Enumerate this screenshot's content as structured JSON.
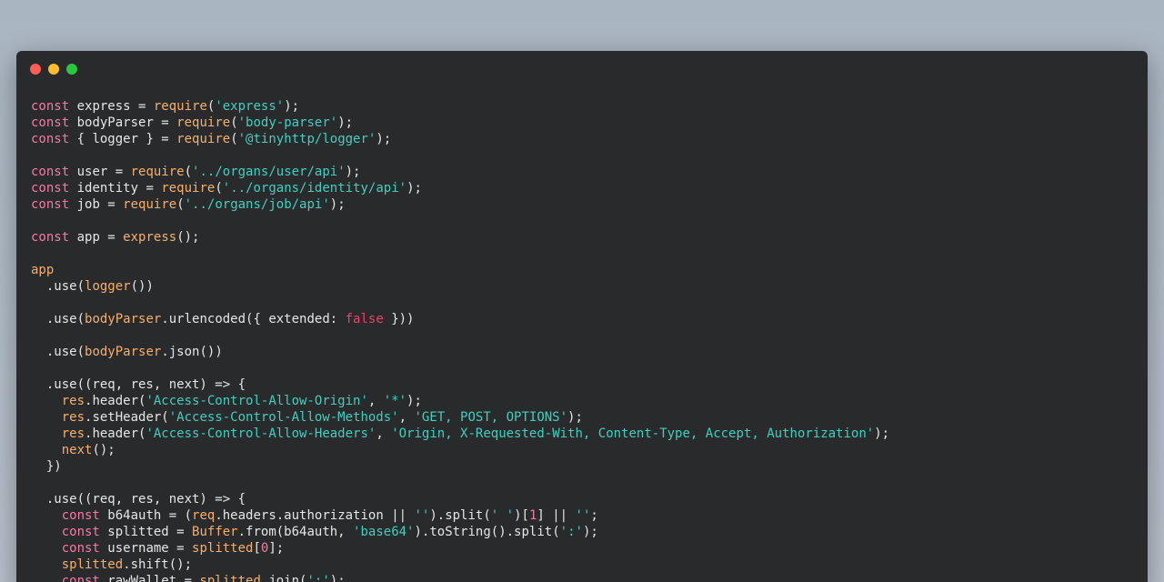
{
  "theme": {
    "background_top": "#a9b5c1",
    "window_bg": "#282a2c",
    "traffic_lights": {
      "close": "#ff5f56",
      "minimize": "#ffbd2e",
      "zoom": "#27c93f"
    },
    "token_colors": {
      "keyword": "#f47ba0",
      "function": "#f5b06a",
      "string": "#3fd0c0",
      "plain": "#e6e6e6",
      "boolean": "#f0406c",
      "number": "#f47ba0"
    }
  },
  "code_lines": [
    [
      [
        "kw",
        "const"
      ],
      [
        "pl",
        " express = "
      ],
      [
        "fn",
        "require"
      ],
      [
        "pl",
        "("
      ],
      [
        "str",
        "'express'"
      ],
      [
        "pl",
        ");"
      ]
    ],
    [
      [
        "kw",
        "const"
      ],
      [
        "pl",
        " bodyParser = "
      ],
      [
        "fn",
        "require"
      ],
      [
        "pl",
        "("
      ],
      [
        "str",
        "'body-parser'"
      ],
      [
        "pl",
        ");"
      ]
    ],
    [
      [
        "kw",
        "const"
      ],
      [
        "pl",
        " { logger } = "
      ],
      [
        "fn",
        "require"
      ],
      [
        "pl",
        "("
      ],
      [
        "str",
        "'@tinyhttp/logger'"
      ],
      [
        "pl",
        ");"
      ]
    ],
    [],
    [
      [
        "kw",
        "const"
      ],
      [
        "pl",
        " user = "
      ],
      [
        "fn",
        "require"
      ],
      [
        "pl",
        "("
      ],
      [
        "str",
        "'../organs/user/api'"
      ],
      [
        "pl",
        ");"
      ]
    ],
    [
      [
        "kw",
        "const"
      ],
      [
        "pl",
        " identity = "
      ],
      [
        "fn",
        "require"
      ],
      [
        "pl",
        "("
      ],
      [
        "str",
        "'../organs/identity/api'"
      ],
      [
        "pl",
        ");"
      ]
    ],
    [
      [
        "kw",
        "const"
      ],
      [
        "pl",
        " job = "
      ],
      [
        "fn",
        "require"
      ],
      [
        "pl",
        "("
      ],
      [
        "str",
        "'../organs/job/api'"
      ],
      [
        "pl",
        ");"
      ]
    ],
    [],
    [
      [
        "kw",
        "const"
      ],
      [
        "pl",
        " app = "
      ],
      [
        "fn",
        "express"
      ],
      [
        "pl",
        "();"
      ]
    ],
    [],
    [
      [
        "fn",
        "app"
      ]
    ],
    [
      [
        "pl",
        "  .use("
      ],
      [
        "fn",
        "logger"
      ],
      [
        "pl",
        "())"
      ]
    ],
    [],
    [
      [
        "pl",
        "  .use("
      ],
      [
        "fn",
        "bodyParser"
      ],
      [
        "pl",
        ".urlencoded({ extended: "
      ],
      [
        "bool",
        "false"
      ],
      [
        "pl",
        " }))"
      ]
    ],
    [],
    [
      [
        "pl",
        "  .use("
      ],
      [
        "fn",
        "bodyParser"
      ],
      [
        "pl",
        ".json())"
      ]
    ],
    [],
    [
      [
        "pl",
        "  .use((req, res, next) => {"
      ]
    ],
    [
      [
        "pl",
        "    "
      ],
      [
        "fn",
        "res"
      ],
      [
        "pl",
        ".header("
      ],
      [
        "str",
        "'Access-Control-Allow-Origin'"
      ],
      [
        "pl",
        ", "
      ],
      [
        "str",
        "'*'"
      ],
      [
        "pl",
        ");"
      ]
    ],
    [
      [
        "pl",
        "    "
      ],
      [
        "fn",
        "res"
      ],
      [
        "pl",
        ".setHeader("
      ],
      [
        "str",
        "'Access-Control-Allow-Methods'"
      ],
      [
        "pl",
        ", "
      ],
      [
        "str",
        "'GET, POST, OPTIONS'"
      ],
      [
        "pl",
        ");"
      ]
    ],
    [
      [
        "pl",
        "    "
      ],
      [
        "fn",
        "res"
      ],
      [
        "pl",
        ".header("
      ],
      [
        "str",
        "'Access-Control-Allow-Headers'"
      ],
      [
        "pl",
        ", "
      ],
      [
        "str",
        "'Origin, X-Requested-With, Content-Type, Accept, Authorization'"
      ],
      [
        "pl",
        ");"
      ]
    ],
    [
      [
        "pl",
        "    "
      ],
      [
        "fn",
        "next"
      ],
      [
        "pl",
        "();"
      ]
    ],
    [
      [
        "pl",
        "  })"
      ]
    ],
    [],
    [
      [
        "pl",
        "  .use((req, res, next) => {"
      ]
    ],
    [
      [
        "pl",
        "    "
      ],
      [
        "kw",
        "const"
      ],
      [
        "pl",
        " b64auth = ("
      ],
      [
        "fn",
        "req"
      ],
      [
        "pl",
        ".headers.authorization || "
      ],
      [
        "str",
        "''"
      ],
      [
        "pl",
        ").split("
      ],
      [
        "str",
        "' '"
      ],
      [
        "pl",
        ")["
      ],
      [
        "num",
        "1"
      ],
      [
        "pl",
        "] || "
      ],
      [
        "str",
        "''"
      ],
      [
        "pl",
        ";"
      ]
    ],
    [
      [
        "pl",
        "    "
      ],
      [
        "kw",
        "const"
      ],
      [
        "pl",
        " splitted = "
      ],
      [
        "fn",
        "Buffer"
      ],
      [
        "pl",
        ".from(b64auth, "
      ],
      [
        "str",
        "'base64'"
      ],
      [
        "pl",
        ").toString().split("
      ],
      [
        "str",
        "':'"
      ],
      [
        "pl",
        ");"
      ]
    ],
    [
      [
        "pl",
        "    "
      ],
      [
        "kw",
        "const"
      ],
      [
        "pl",
        " username = "
      ],
      [
        "fn",
        "splitted"
      ],
      [
        "pl",
        "["
      ],
      [
        "num",
        "0"
      ],
      [
        "pl",
        "];"
      ]
    ],
    [
      [
        "pl",
        "    "
      ],
      [
        "fn",
        "splitted"
      ],
      [
        "pl",
        ".shift();"
      ]
    ],
    [
      [
        "pl",
        "    "
      ],
      [
        "kw",
        "const"
      ],
      [
        "pl",
        " rawWallet = "
      ],
      [
        "fn",
        "splitted"
      ],
      [
        "pl",
        ".join("
      ],
      [
        "str",
        "':'"
      ],
      [
        "pl",
        ");"
      ]
    ]
  ]
}
